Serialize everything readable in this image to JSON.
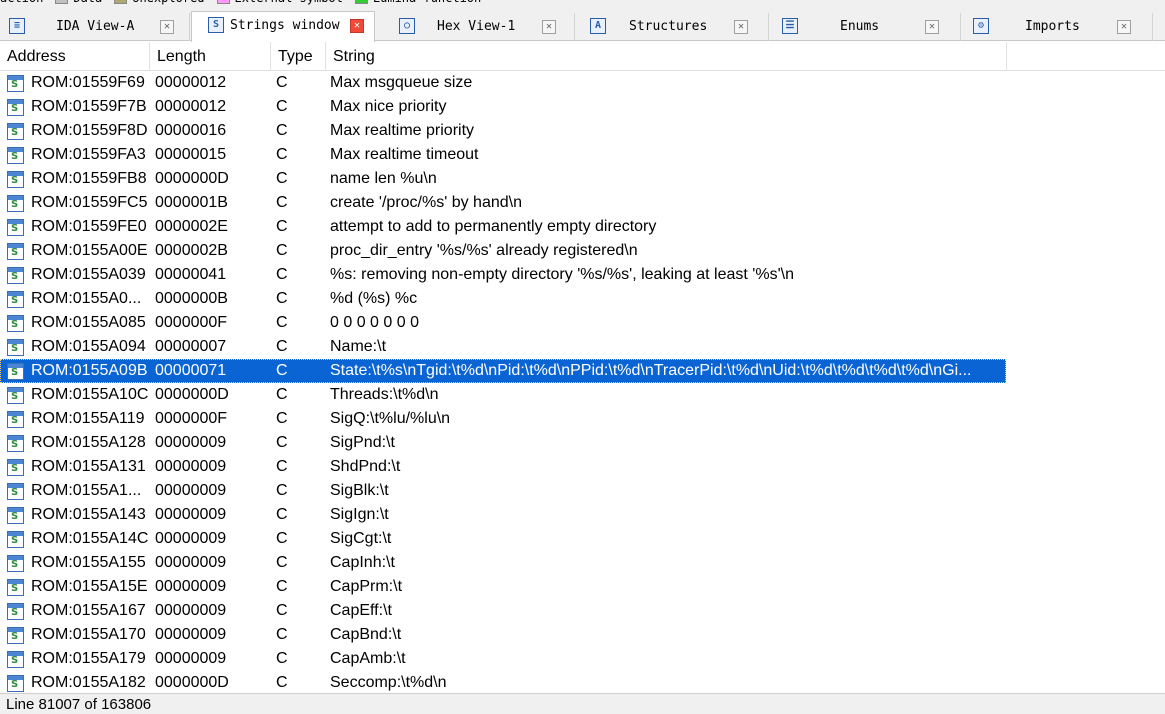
{
  "legend": [
    {
      "label": "action",
      "color": "#f0f0f0"
    },
    {
      "label": "Data",
      "color": "#c0c0c0"
    },
    {
      "label": "Unexplored",
      "color": "#b0a670"
    },
    {
      "label": "External symbol",
      "color": "#ff99ff"
    },
    {
      "label": "Lumina function",
      "color": "#33cc33"
    }
  ],
  "tabs": [
    {
      "label": "IDA View-A",
      "icon": "ida-view-icon",
      "glyph": "≡",
      "active": false
    },
    {
      "label": "Strings window",
      "icon": "strings-icon",
      "glyph": "S",
      "active": true
    },
    {
      "label": "Hex View-1",
      "icon": "hex-view-icon",
      "glyph": "○",
      "active": false
    },
    {
      "label": "Structures",
      "icon": "structures-icon",
      "glyph": "A",
      "active": false
    },
    {
      "label": "Enums",
      "icon": "enums-icon",
      "glyph": "☰",
      "active": false
    },
    {
      "label": "Imports",
      "icon": "imports-icon",
      "glyph": "⚙",
      "active": false
    }
  ],
  "table": {
    "columns": [
      "Address",
      "Length",
      "Type",
      "String"
    ],
    "selected_index": 12,
    "rows": [
      {
        "address": "ROM:01559F69",
        "length": "00000012",
        "type": "C",
        "string": "Max msgqueue size"
      },
      {
        "address": "ROM:01559F7B",
        "length": "00000012",
        "type": "C",
        "string": "Max nice priority"
      },
      {
        "address": "ROM:01559F8D",
        "length": "00000016",
        "type": "C",
        "string": "Max realtime priority"
      },
      {
        "address": "ROM:01559FA3",
        "length": "00000015",
        "type": "C",
        "string": "Max realtime timeout"
      },
      {
        "address": "ROM:01559FB8",
        "length": "0000000D",
        "type": "C",
        "string": "name len %u\\n"
      },
      {
        "address": "ROM:01559FC5",
        "length": "0000001B",
        "type": "C",
        "string": "create '/proc/%s' by hand\\n"
      },
      {
        "address": "ROM:01559FE0",
        "length": "0000002E",
        "type": "C",
        "string": "attempt to add to permanently empty directory"
      },
      {
        "address": "ROM:0155A00E",
        "length": "0000002B",
        "type": "C",
        "string": "proc_dir_entry '%s/%s' already registered\\n"
      },
      {
        "address": "ROM:0155A039",
        "length": "00000041",
        "type": "C",
        "string": "%s: removing non-empty directory '%s/%s', leaking at least '%s'\\n"
      },
      {
        "address": "ROM:0155A0...",
        "length": "0000000B",
        "type": "C",
        "string": "%d (%s) %c"
      },
      {
        "address": "ROM:0155A085",
        "length": "0000000F",
        "type": "C",
        "string": " 0 0 0 0 0 0 0"
      },
      {
        "address": "ROM:0155A094",
        "length": "00000007",
        "type": "C",
        "string": "Name:\\t"
      },
      {
        "address": "ROM:0155A09B",
        "length": "00000071",
        "type": "C",
        "string": "State:\\t%s\\nTgid:\\t%d\\nPid:\\t%d\\nPPid:\\t%d\\nTracerPid:\\t%d\\nUid:\\t%d\\t%d\\t%d\\t%d\\nGi..."
      },
      {
        "address": "ROM:0155A10C",
        "length": "0000000D",
        "type": "C",
        "string": "Threads:\\t%d\\n"
      },
      {
        "address": "ROM:0155A119",
        "length": "0000000F",
        "type": "C",
        "string": "SigQ:\\t%lu/%lu\\n"
      },
      {
        "address": "ROM:0155A128",
        "length": "00000009",
        "type": "C",
        "string": "SigPnd:\\t"
      },
      {
        "address": "ROM:0155A131",
        "length": "00000009",
        "type": "C",
        "string": "ShdPnd:\\t"
      },
      {
        "address": "ROM:0155A1...",
        "length": "00000009",
        "type": "C",
        "string": "SigBlk:\\t"
      },
      {
        "address": "ROM:0155A143",
        "length": "00000009",
        "type": "C",
        "string": "SigIgn:\\t"
      },
      {
        "address": "ROM:0155A14C",
        "length": "00000009",
        "type": "C",
        "string": "SigCgt:\\t"
      },
      {
        "address": "ROM:0155A155",
        "length": "00000009",
        "type": "C",
        "string": "CapInh:\\t"
      },
      {
        "address": "ROM:0155A15E",
        "length": "00000009",
        "type": "C",
        "string": "CapPrm:\\t"
      },
      {
        "address": "ROM:0155A167",
        "length": "00000009",
        "type": "C",
        "string": "CapEff:\\t"
      },
      {
        "address": "ROM:0155A170",
        "length": "00000009",
        "type": "C",
        "string": "CapBnd:\\t"
      },
      {
        "address": "ROM:0155A179",
        "length": "00000009",
        "type": "C",
        "string": "CapAmb:\\t"
      },
      {
        "address": "ROM:0155A182",
        "length": "0000000D",
        "type": "C",
        "string": "Seccomp:\\t%d\\n"
      }
    ]
  },
  "status": {
    "text": "Line 81007 of 163806"
  },
  "colors": {
    "selection": "#0a64d4",
    "tab_close_active": "#f04a3a"
  }
}
